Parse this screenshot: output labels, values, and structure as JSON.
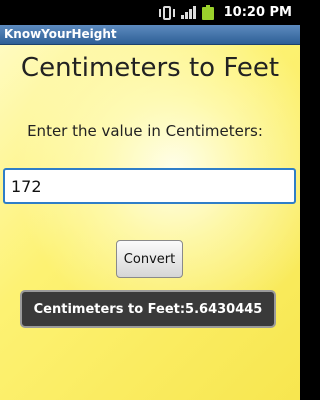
{
  "status_bar": {
    "time": "10:20 PM",
    "icons": [
      "vibrate-icon",
      "signal-icon",
      "battery-icon"
    ],
    "battery_color": "#9ad12b"
  },
  "app": {
    "title": "KnowYourHeight",
    "titlebar_color": "#2e5f96"
  },
  "main": {
    "heading": "Centimeters to Feet",
    "prompt": "Enter the value in Centimeters:",
    "input_value": "172",
    "convert_label": "Convert",
    "result_text": "Centimeters to Feet:5.6430445"
  }
}
